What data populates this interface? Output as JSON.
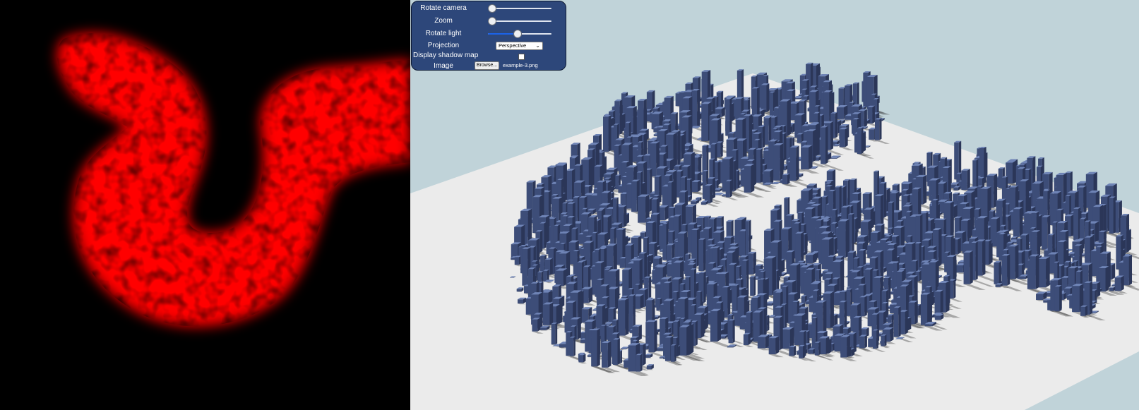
{
  "colors": {
    "heightmap_background": "#000000",
    "heightmap_color": "#ff0000",
    "sky": "#c0d3d9",
    "ground": "#ebebeb",
    "building": "#55689a",
    "panel_background": "#2d477a"
  },
  "controls": {
    "rotate_camera": {
      "label": "Rotate camera",
      "value": 0.0
    },
    "zoom": {
      "label": "Zoom",
      "value": 0.0
    },
    "rotate_light": {
      "label": "Rotate light",
      "value": 0.45
    },
    "projection": {
      "label": "Projection",
      "selected": "Perspective"
    },
    "shadow_map": {
      "label": "Display shadow map",
      "checked": false
    },
    "image": {
      "label": "Image",
      "button_label": "Browse...",
      "file_name": "example-3.png"
    }
  }
}
